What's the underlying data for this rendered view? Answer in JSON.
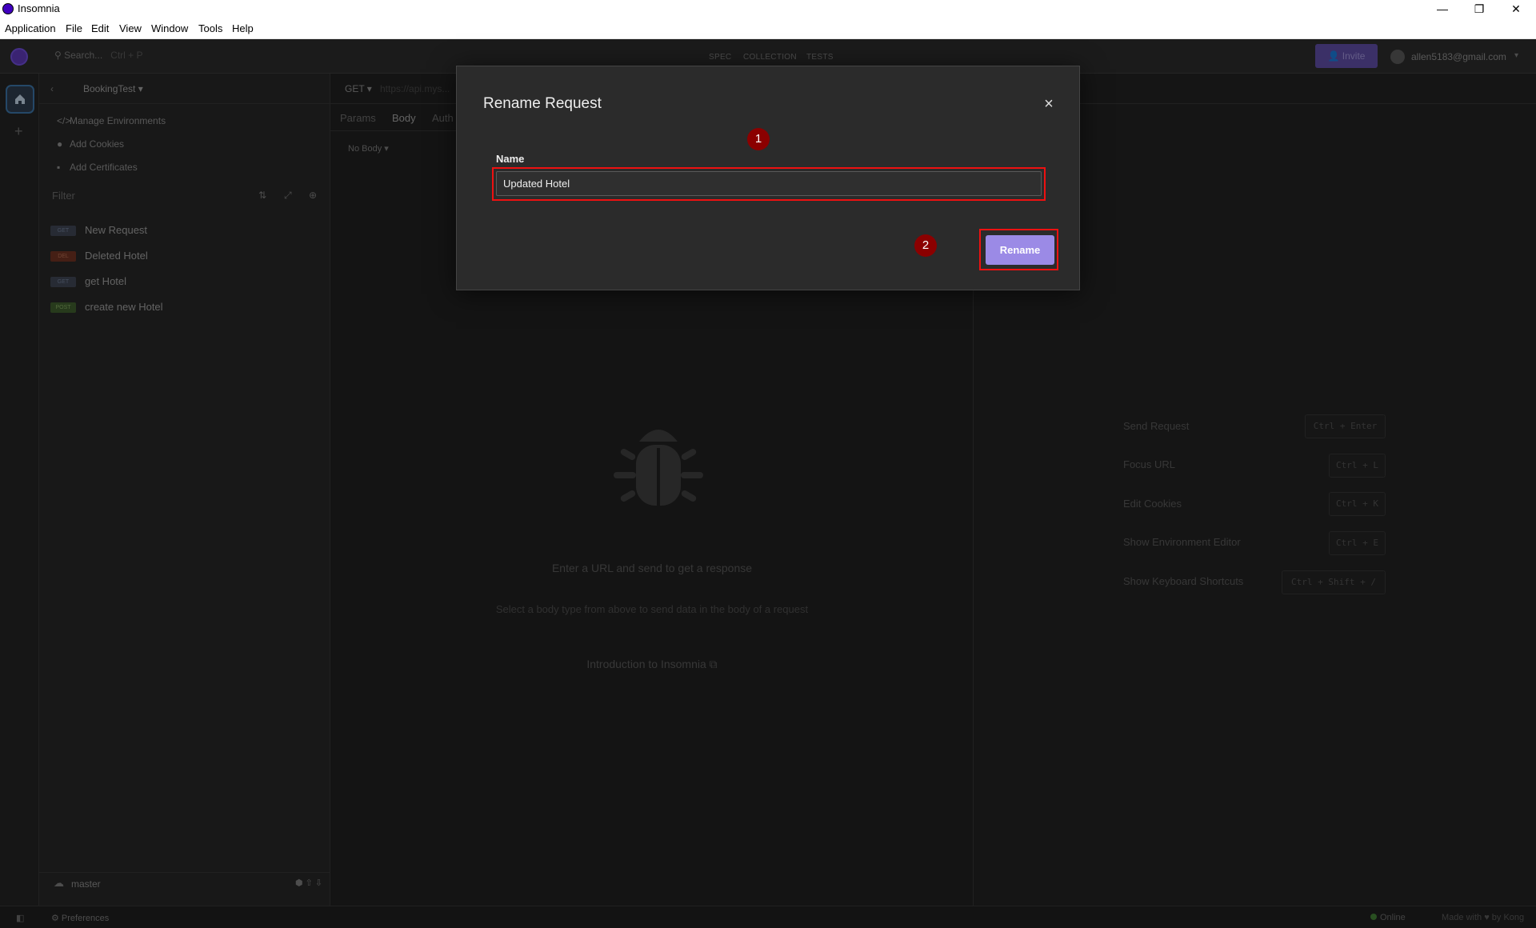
{
  "window": {
    "title": "Insomnia",
    "minimize": "—",
    "maximize": "❐",
    "close": "✕"
  },
  "menu": [
    "Application",
    "File",
    "Edit",
    "View",
    "Window",
    "Tools",
    "Help"
  ],
  "header": {
    "search_placeholder": "Search...",
    "search_shortcut": "Ctrl + P",
    "tabs": [
      "SPEC",
      "COLLECTION",
      "TESTS"
    ],
    "invite_label": "Invite",
    "user_email": "allen5183@gmail.com"
  },
  "sidebar": {
    "project": "BookingTest",
    "links": [
      {
        "icon": "code-icon",
        "label": "Manage Environments"
      },
      {
        "icon": "cookie-icon",
        "label": "Add Cookies"
      },
      {
        "icon": "certificate-icon",
        "label": "Add Certificates"
      }
    ],
    "filter_placeholder": "Filter",
    "requests": [
      {
        "method": "GET",
        "name": "New Request"
      },
      {
        "method": "DEL",
        "name": "Deleted Hotel"
      },
      {
        "method": "GET",
        "name": "get Hotel"
      },
      {
        "method": "POST",
        "name": "create new Hotel"
      }
    ],
    "branch": "master"
  },
  "request": {
    "method": "GET",
    "url": "https://api.mys...",
    "tabs": [
      "Params",
      "Body",
      "Auth"
    ],
    "body_type": "No Body",
    "empty_title": "Enter a URL and send to get a response",
    "empty_hint": "Select a body type from above to send data in the body of a request",
    "intro_link": "Introduction to Insomnia"
  },
  "shortcuts": [
    {
      "label": "Send Request",
      "keys": "Ctrl + Enter"
    },
    {
      "label": "Focus URL",
      "keys": "Ctrl + L"
    },
    {
      "label": "Edit Cookies",
      "keys": "Ctrl + K"
    },
    {
      "label": "Show Environment Editor",
      "keys": "Ctrl + E"
    },
    {
      "label": "Show Keyboard Shortcuts",
      "keys": "Ctrl + Shift + /"
    }
  ],
  "status": {
    "preferences": "Preferences",
    "online": "Online",
    "made_with": "Made with ♥ by Kong"
  },
  "modal": {
    "title": "Rename Request",
    "field_label": "Name",
    "field_value": "Updated Hotel",
    "submit_label": "Rename",
    "close_icon": "×",
    "badge_1": "1",
    "badge_2": "2"
  },
  "colors": {
    "accent": "#9b8ae6",
    "highlight": "#ee1111",
    "badge": "#8b0000"
  }
}
